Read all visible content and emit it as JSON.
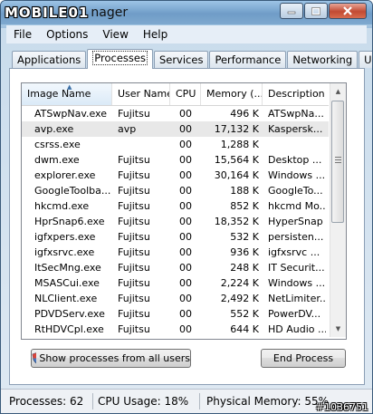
{
  "title_logo": "MOBILE01",
  "title_suffix": "nager",
  "menu": [
    "File",
    "Options",
    "View",
    "Help"
  ],
  "tabs": [
    "Applications",
    "Processes",
    "Services",
    "Performance",
    "Networking",
    "Users"
  ],
  "active_tab": "Processes",
  "columns": [
    "Image Name",
    "User Name",
    "CPU",
    "Memory (...",
    "Description"
  ],
  "processes": [
    {
      "name": "ATSwpNav.exe",
      "user": "Fujitsu",
      "cpu": "00",
      "mem": "496 K",
      "desc": "ATSwpNa..."
    },
    {
      "name": "avp.exe",
      "user": "avp",
      "cpu": "00",
      "mem": "17,132 K",
      "desc": "Kaspersk..."
    },
    {
      "name": "csrss.exe",
      "user": "",
      "cpu": "00",
      "mem": "1,288 K",
      "desc": ""
    },
    {
      "name": "dwm.exe",
      "user": "Fujitsu",
      "cpu": "00",
      "mem": "15,564 K",
      "desc": "Desktop ..."
    },
    {
      "name": "explorer.exe",
      "user": "Fujitsu",
      "cpu": "00",
      "mem": "30,164 K",
      "desc": "Windows ..."
    },
    {
      "name": "GoogleToolba...",
      "user": "Fujitsu",
      "cpu": "00",
      "mem": "188 K",
      "desc": "GoogleTo..."
    },
    {
      "name": "hkcmd.exe",
      "user": "Fujitsu",
      "cpu": "00",
      "mem": "852 K",
      "desc": "hkcmd Mo..."
    },
    {
      "name": "HprSnap6.exe",
      "user": "Fujitsu",
      "cpu": "00",
      "mem": "18,352 K",
      "desc": "HyperSnap"
    },
    {
      "name": "igfxpers.exe",
      "user": "Fujitsu",
      "cpu": "00",
      "mem": "532 K",
      "desc": "persisten..."
    },
    {
      "name": "igfxsrvc.exe",
      "user": "Fujitsu",
      "cpu": "00",
      "mem": "936 K",
      "desc": "igfxsrvc ..."
    },
    {
      "name": "ItSecMng.exe",
      "user": "Fujitsu",
      "cpu": "00",
      "mem": "248 K",
      "desc": "IT Securit..."
    },
    {
      "name": "MSASCui.exe",
      "user": "Fujitsu",
      "cpu": "00",
      "mem": "2,224 K",
      "desc": "Windows ..."
    },
    {
      "name": "NLClient.exe",
      "user": "Fujitsu",
      "cpu": "00",
      "mem": "2,492 K",
      "desc": "NetLimiter..."
    },
    {
      "name": "PDVDServ.exe",
      "user": "Fujitsu",
      "cpu": "00",
      "mem": "552 K",
      "desc": "PowerDV..."
    },
    {
      "name": "RtHDVCpl.exe",
      "user": "Fujitsu",
      "cpu": "00",
      "mem": "644 K",
      "desc": "HD Audio ..."
    }
  ],
  "selected_process": "avp.exe",
  "buttons": {
    "show_all": "Show processes from all users",
    "end_process": "End Process"
  },
  "status": {
    "processes": "Processes: 62",
    "cpu": "CPU Usage: 18%",
    "memory": "Physical Memory: 55%"
  },
  "watermark": "#1036751",
  "colors": {
    "selection": "#e8e8e8",
    "title_gradient": "#6f9cc7",
    "close": "#c24a32"
  }
}
